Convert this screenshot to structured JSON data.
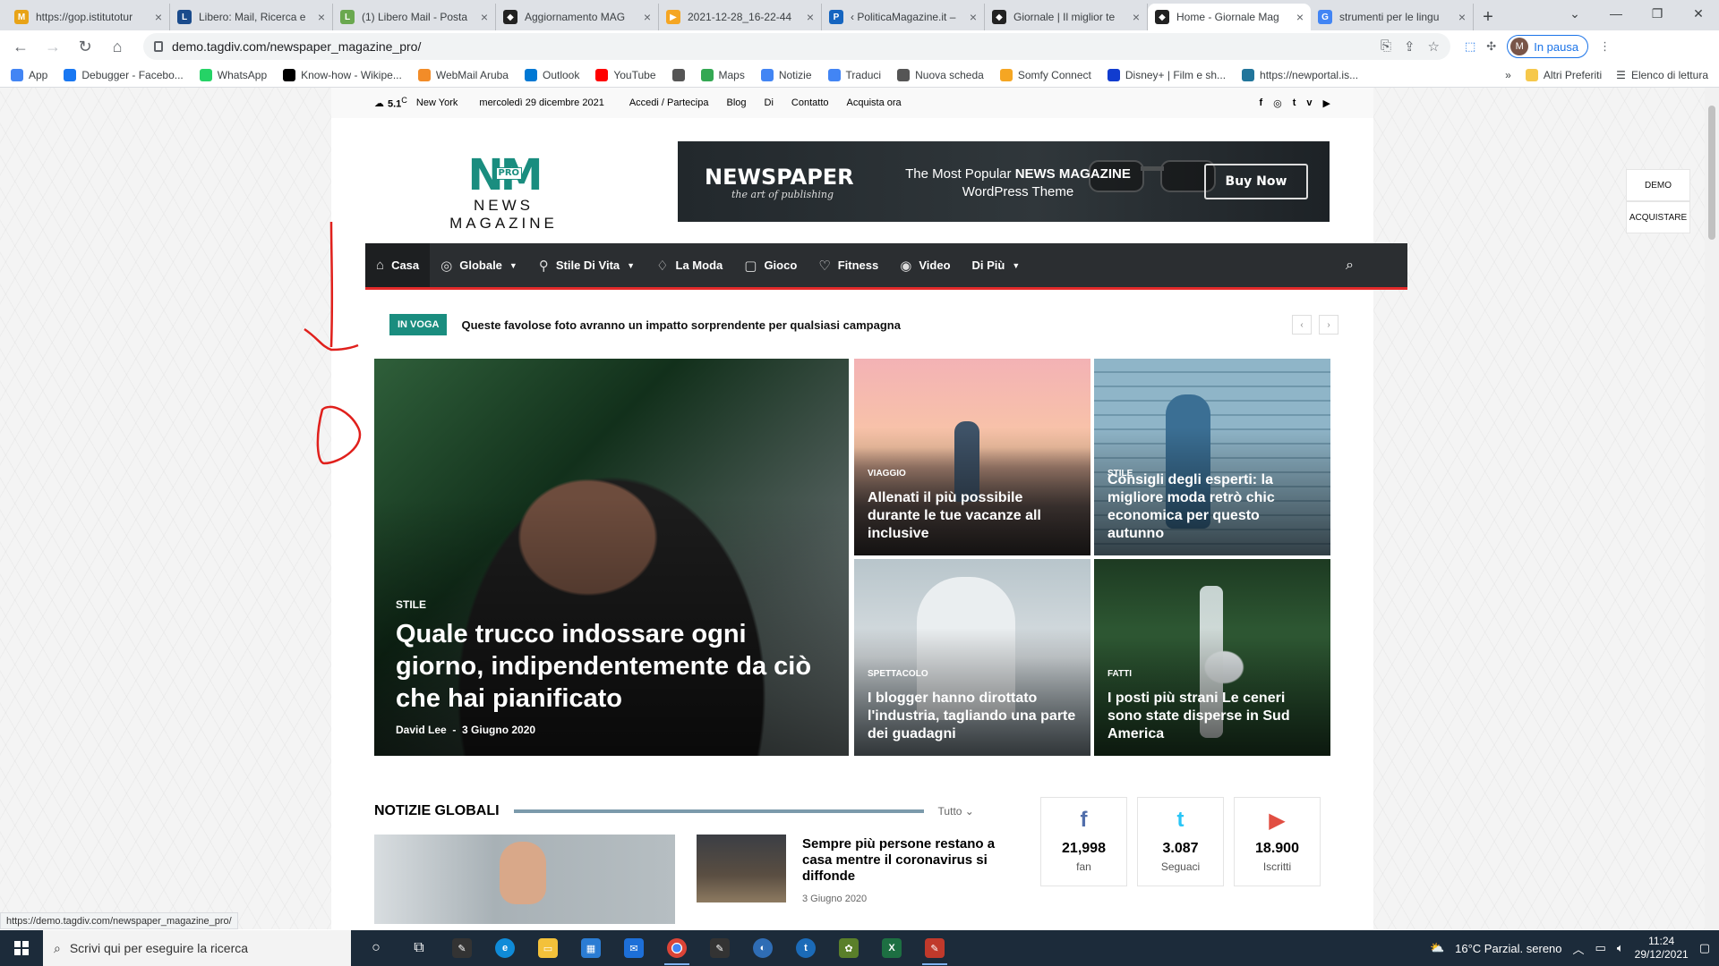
{
  "browser": {
    "tabs": [
      {
        "title": "https://gop.istitutotur",
        "color": "#e8a317",
        "glyph": "M"
      },
      {
        "title": "Libero: Mail, Ricerca e",
        "color": "#1a4b8c",
        "glyph": "L"
      },
      {
        "title": "(1) Libero Mail - Posta",
        "color": "#6aa84f",
        "glyph": "L"
      },
      {
        "title": "Aggiornamento MAG",
        "color": "#222222",
        "glyph": "◆"
      },
      {
        "title": "2021-12-28_16-22-44",
        "color": "#f5a623",
        "glyph": "▶"
      },
      {
        "title": "‹ PoliticaMagazine.it –",
        "color": "#1565c0",
        "glyph": "P"
      },
      {
        "title": "Giornale | Il miglior te",
        "color": "#222222",
        "glyph": "◆"
      },
      {
        "title": "Home - Giornale Mag",
        "color": "#222222",
        "glyph": "◆",
        "active": true
      },
      {
        "title": "strumenti per le lingu",
        "color": "#4285f4",
        "glyph": "G"
      }
    ],
    "url": "demo.tagdiv.com/newspaper_magazine_pro/",
    "profile_label": "In pausa",
    "profile_initial": "M",
    "bookmarks": [
      {
        "label": "App",
        "color": "#4285f4"
      },
      {
        "label": "Debugger - Facebo...",
        "color": "#1877f2"
      },
      {
        "label": "WhatsApp",
        "color": "#25d366"
      },
      {
        "label": "Know-how - Wikipe...",
        "color": "#000000"
      },
      {
        "label": "WebMail Aruba",
        "color": "#f28c28"
      },
      {
        "label": "Outlook",
        "color": "#0078d4"
      },
      {
        "label": "YouTube",
        "color": "#ff0000"
      },
      {
        "label": "",
        "color": "#555555"
      },
      {
        "label": "Maps",
        "color": "#34a853"
      },
      {
        "label": "Notizie",
        "color": "#4285f4"
      },
      {
        "label": "Traduci",
        "color": "#4285f4"
      },
      {
        "label": "Nuova scheda",
        "color": "#555555"
      },
      {
        "label": "Somfy Connect",
        "color": "#f5a623"
      },
      {
        "label": "Disney+ | Film e sh...",
        "color": "#113ccf"
      },
      {
        "label": "https://newportal.is...",
        "color": "#21759b"
      }
    ],
    "bookmarks_more": "»",
    "other_bookmarks": "Altri Preferiti",
    "reading_list": "Elenco di lettura",
    "status_url": "https://demo.tagdiv.com/newspaper_magazine_pro/"
  },
  "site": {
    "topbar": {
      "temp": "5.1",
      "temp_unit": "C",
      "city": "New York",
      "date": "mercoledì 29 dicembre 2021",
      "links": [
        "Accedi / Partecipa",
        "Blog",
        "Di",
        "Contatto",
        "Acquista ora"
      ],
      "social": [
        "f",
        "◎",
        "t",
        "v",
        "▶"
      ]
    },
    "logo": {
      "mark": "NM",
      "badge": "PRO",
      "name": "NEWS MAGAZINE"
    },
    "banner": {
      "title": "NEWSPAPER",
      "subtitle": "the art of publishing",
      "tag_line1_pre": "The Most Popular ",
      "tag_line1_bold": "NEWS MAGAZINE",
      "tag_line2": "WordPress Theme",
      "button": "Buy Now"
    },
    "nav": [
      {
        "label": "Casa",
        "icon": "home-icon",
        "glyph": "⌂",
        "active": true,
        "caret": false
      },
      {
        "label": "Globale",
        "icon": "globe-icon",
        "glyph": "◎",
        "caret": true
      },
      {
        "label": "Stile Di Vita",
        "icon": "bicycle-icon",
        "glyph": "⚲",
        "caret": true
      },
      {
        "label": "La Moda",
        "icon": "fashion-icon",
        "glyph": "♢",
        "caret": false
      },
      {
        "label": "Gioco",
        "icon": "game-icon",
        "glyph": "▢",
        "caret": false
      },
      {
        "label": "Fitness",
        "icon": "heart-icon",
        "glyph": "♡",
        "caret": false
      },
      {
        "label": "Video",
        "icon": "video-icon",
        "glyph": "◉",
        "caret": false
      },
      {
        "label": "Di Più",
        "icon": "",
        "glyph": "",
        "caret": true
      }
    ],
    "ticker": {
      "badge": "IN VOGA",
      "text": "Queste favolose foto avranno un impatto sorprendente per qualsiasi campagna"
    },
    "featured": {
      "big": {
        "category": "STILE",
        "title": "Quale trucco indossare ogni giorno, indipendentemente da ciò che hai pianificato",
        "author": "David Lee",
        "date": "3 Giugno 2020"
      },
      "small": [
        {
          "category": "VIAGGIO",
          "title": "Allenati il più possibile durante le tue vacanze all inclusive"
        },
        {
          "category": "STILE",
          "title": "Consigli degli esperti: la migliore moda retrò chic economica per questo autunno"
        },
        {
          "category": "SPETTACOLO",
          "title": "I blogger hanno dirottato l'industria, tagliando una parte dei guadagni"
        },
        {
          "category": "FATTI",
          "title": "I posti più strani Le ceneri sono state disperse in Sud America"
        }
      ]
    },
    "global_news": {
      "title": "NOTIZIE GLOBALI",
      "filter": "Tutto",
      "article_title": "Sempre più persone restano a casa mentre il coronavirus si diffonde",
      "article_date": "3 Giugno 2020"
    },
    "socials": [
      {
        "icon": "f",
        "count": "21,998",
        "label": "fan",
        "color": "#516eab"
      },
      {
        "icon": "t",
        "count": "3.087",
        "label": "Seguaci",
        "color": "#29c5f6"
      },
      {
        "icon": "▶",
        "count": "18.900",
        "label": "Iscritti",
        "color": "#e14e42"
      }
    ],
    "side_buttons": [
      "DEMO",
      "ACQUISTARE"
    ]
  },
  "taskbar": {
    "search_placeholder": "Scrivi qui per eseguire la ricerca",
    "weather": "16°C  Parzial. sereno",
    "time": "11:24",
    "date": "29/12/2021"
  }
}
